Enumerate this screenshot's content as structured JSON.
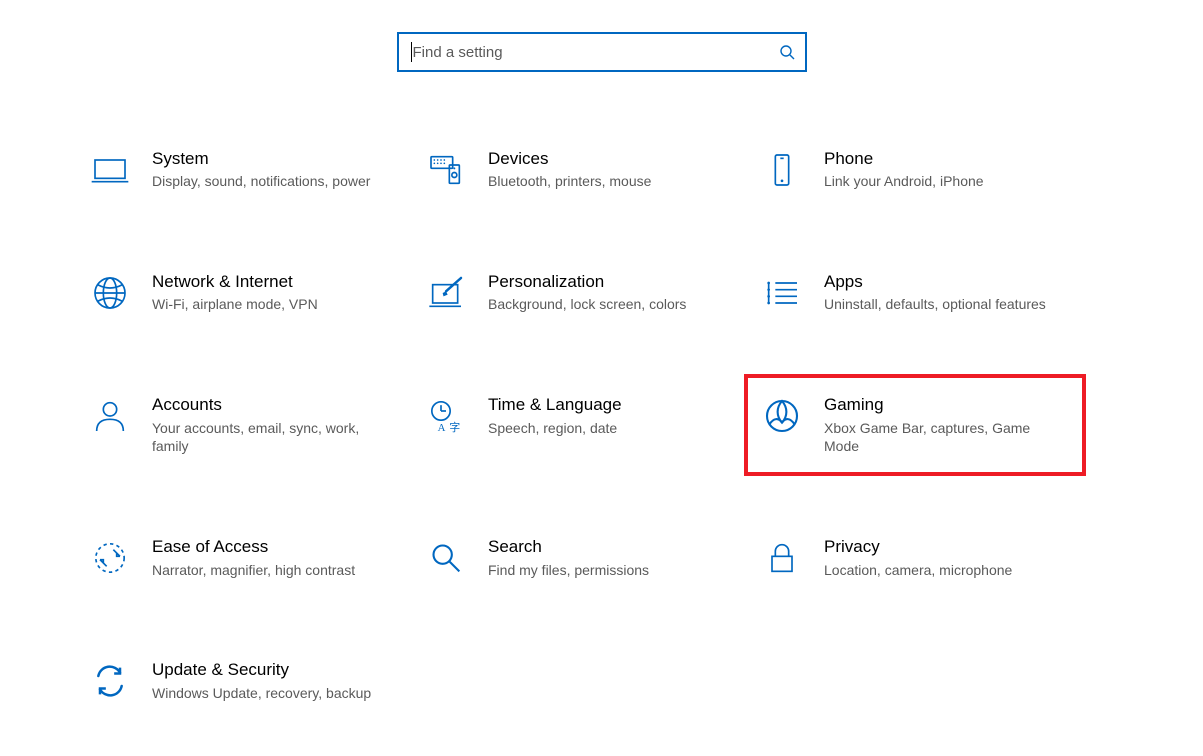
{
  "search": {
    "placeholder": "Find a setting",
    "value": ""
  },
  "tiles": [
    {
      "id": "system",
      "title": "System",
      "desc": "Display, sound, notifications, power"
    },
    {
      "id": "devices",
      "title": "Devices",
      "desc": "Bluetooth, printers, mouse"
    },
    {
      "id": "phone",
      "title": "Phone",
      "desc": "Link your Android, iPhone"
    },
    {
      "id": "network",
      "title": "Network & Internet",
      "desc": "Wi-Fi, airplane mode, VPN"
    },
    {
      "id": "personalization",
      "title": "Personalization",
      "desc": "Background, lock screen, colors"
    },
    {
      "id": "apps",
      "title": "Apps",
      "desc": "Uninstall, defaults, optional features"
    },
    {
      "id": "accounts",
      "title": "Accounts",
      "desc": "Your accounts, email, sync, work, family"
    },
    {
      "id": "time-language",
      "title": "Time & Language",
      "desc": "Speech, region, date"
    },
    {
      "id": "gaming",
      "title": "Gaming",
      "desc": "Xbox Game Bar, captures, Game Mode",
      "highlighted": true
    },
    {
      "id": "ease-of-access",
      "title": "Ease of Access",
      "desc": "Narrator, magnifier, high contrast"
    },
    {
      "id": "search",
      "title": "Search",
      "desc": "Find my files, permissions"
    },
    {
      "id": "privacy",
      "title": "Privacy",
      "desc": "Location, camera, microphone"
    },
    {
      "id": "update-security",
      "title": "Update & Security",
      "desc": "Windows Update, recovery, backup"
    }
  ],
  "colors": {
    "accent": "#0067c0",
    "highlight": "#ee1c25"
  }
}
